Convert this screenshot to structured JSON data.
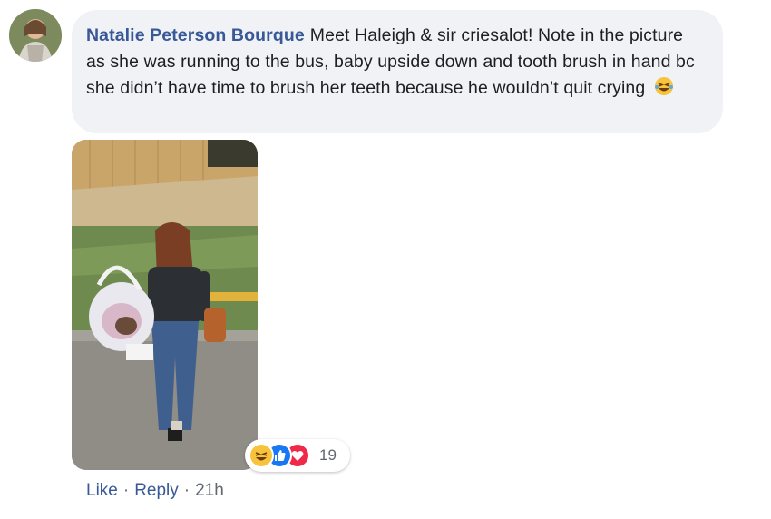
{
  "comment": {
    "author": "Natalie Peterson Bourque",
    "text": "Meet Haleigh & sir criesalot! Note in the picture as she was running to the bus, baby upside down and tooth brush in hand bc she didn’t have time to brush her teeth because he wouldn’t quit crying",
    "emoji_icon": "laughing-crying-emoji-icon"
  },
  "reactions": {
    "types": [
      "haha-icon",
      "like-icon",
      "love-icon"
    ],
    "count": "19"
  },
  "actions": {
    "like_label": "Like",
    "separator": "·",
    "reply_label": "Reply",
    "timestamp": "21h"
  },
  "colors": {
    "author_link": "#385898",
    "bubble_bg": "#f0f2f5",
    "like_blue": "#1877f2",
    "love_red": "#f0284a",
    "haha_yellow": "#f7c33b"
  }
}
